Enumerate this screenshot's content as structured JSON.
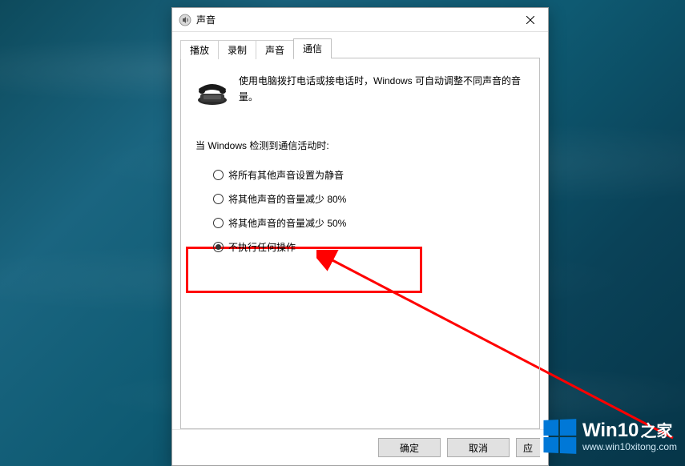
{
  "window": {
    "title": "声音"
  },
  "tabs": [
    {
      "label": "播放",
      "active": false
    },
    {
      "label": "录制",
      "active": false
    },
    {
      "label": "声音",
      "active": false
    },
    {
      "label": "通信",
      "active": true
    }
  ],
  "content": {
    "description": "使用电脑拨打电话或接电话时，Windows 可自动调整不同声音的音量。",
    "section_label": "当 Windows 检测到通信活动时:",
    "options": [
      {
        "label": "将所有其他声音设置为静音",
        "checked": false
      },
      {
        "label": "将其他声音的音量减少 80%",
        "checked": false
      },
      {
        "label": "将其他声音的音量减少 50%",
        "checked": false
      },
      {
        "label": "不执行任何操作",
        "checked": true
      }
    ]
  },
  "buttons": {
    "ok": "确定",
    "cancel": "取消",
    "apply_partial": "应"
  },
  "watermark": {
    "brand_en": "Win10",
    "brand_zh": "之家",
    "url": "www.win10xitong.com"
  }
}
